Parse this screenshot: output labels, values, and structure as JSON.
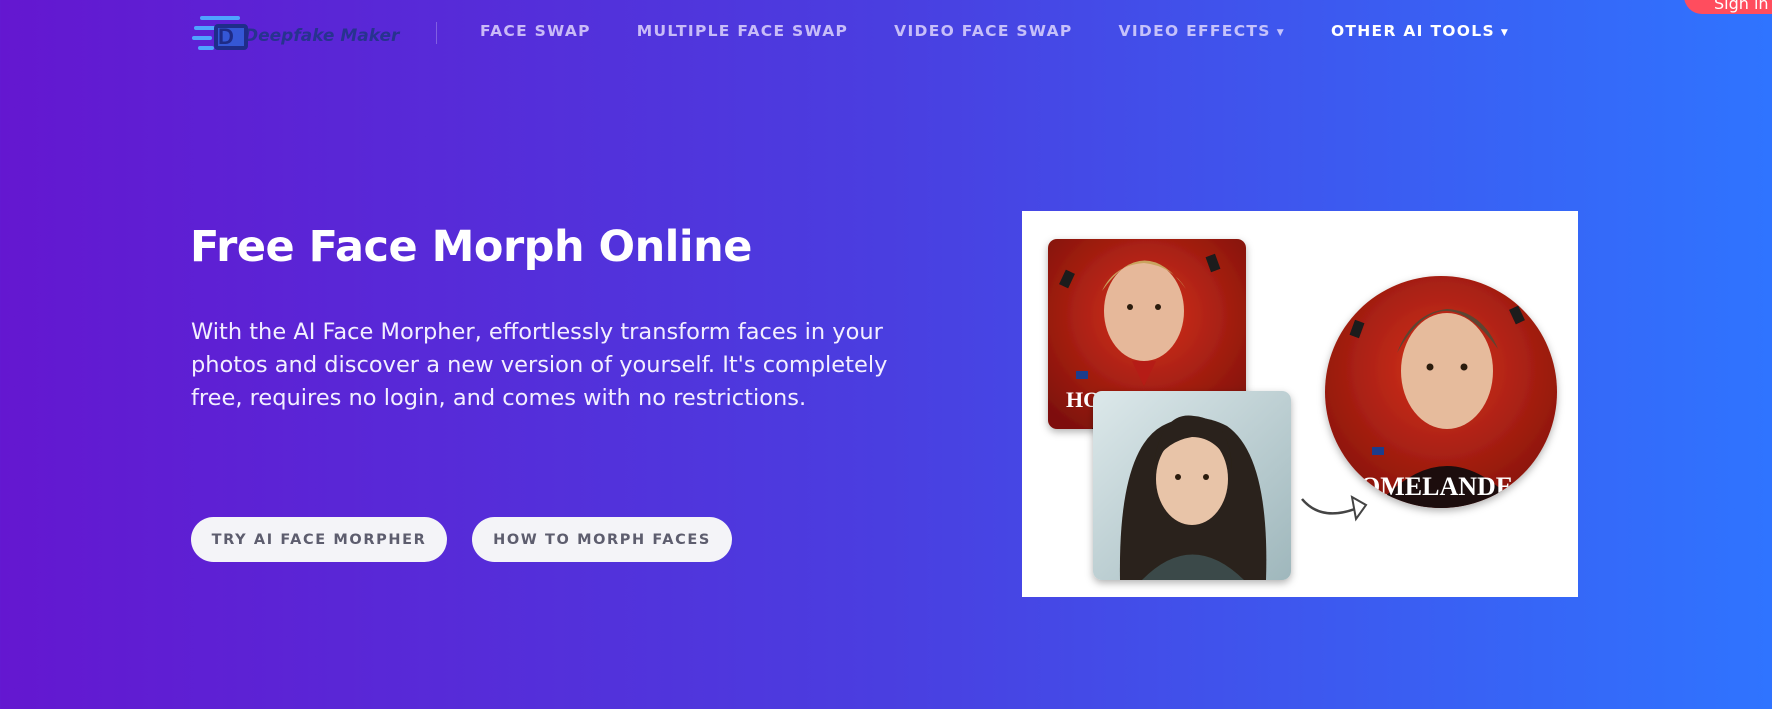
{
  "header": {
    "logo_text": "Deepfake Maker",
    "nav": [
      {
        "label": "FACE SWAP",
        "dropdown": false
      },
      {
        "label": "MULTIPLE FACE SWAP",
        "dropdown": false
      },
      {
        "label": "VIDEO FACE SWAP",
        "dropdown": false
      },
      {
        "label": "VIDEO EFFECTS",
        "dropdown": true
      },
      {
        "label": "OTHER AI TOOLS",
        "dropdown": true
      }
    ],
    "signin_label": "Sign in"
  },
  "hero": {
    "title": "Free Face Morph Online",
    "description": "With the AI Face Morpher, effortlessly transform faces in your photos and discover a new version of yourself. It's completely free, requires no login, and comes with no restrictions.",
    "buttons": {
      "primary": "TRY AI FACE MORPHER",
      "secondary": "HOW TO MORPH FACES"
    }
  },
  "illustration": {
    "source_text": "HO",
    "result_text": "OMELANDE"
  },
  "colors": {
    "gradient_start": "#6417d0",
    "gradient_end": "#2f74ff",
    "signin_bg": "#ff4d5e",
    "button_bg": "#f4f4f8"
  }
}
